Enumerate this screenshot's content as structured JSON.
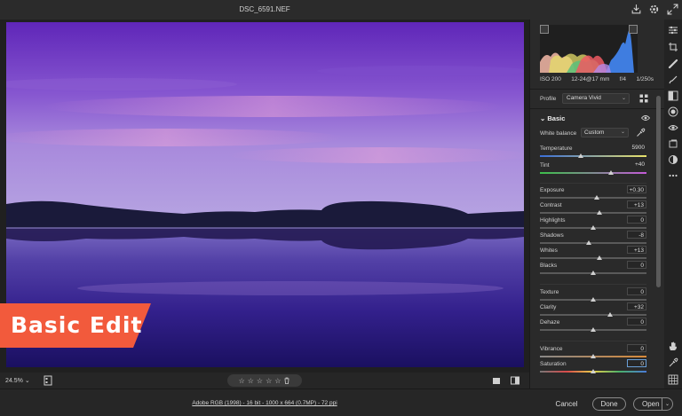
{
  "window": {
    "title": "DSC_6591.NEF"
  },
  "overlay": {
    "label": "Basic Edit",
    "color": "#f25a3c"
  },
  "toolbar": {
    "zoom": "24.5%",
    "zoom_caret": "⌄"
  },
  "rating": {
    "stars": [
      "☆",
      "☆",
      "☆",
      "☆",
      "☆"
    ]
  },
  "footer": {
    "file_info": "Adobe RGB (1998) - 16 bit - 1000 x 664 (0.7MP) - 72 ppi",
    "cancel": "Cancel",
    "done": "Done",
    "open": "Open",
    "open_caret": "⌄"
  },
  "exif": {
    "iso": "ISO 200",
    "lens": "12-24@17 mm",
    "aperture": "f/4",
    "shutter": "1/250s"
  },
  "profile": {
    "label": "Profile",
    "value": "Camera Vivid"
  },
  "basic": {
    "title": "Basic",
    "white_balance_label": "White balance",
    "white_balance_value": "Custom",
    "sliders": [
      {
        "label": "Temperature",
        "value": "5900",
        "pos": 0.38,
        "boxed": false,
        "track": "temp"
      },
      {
        "label": "Tint",
        "value": "+40",
        "pos": 0.67,
        "boxed": false,
        "track": "tint"
      },
      {
        "label": "Exposure",
        "value": "+0.30",
        "pos": 0.53,
        "boxed": true,
        "track": "plain"
      },
      {
        "label": "Contrast",
        "value": "+13",
        "pos": 0.56,
        "boxed": true,
        "track": "plain"
      },
      {
        "label": "Highlights",
        "value": "0",
        "pos": 0.5,
        "boxed": true,
        "track": "plain"
      },
      {
        "label": "Shadows",
        "value": "-8",
        "pos": 0.46,
        "boxed": true,
        "track": "plain"
      },
      {
        "label": "Whites",
        "value": "+13",
        "pos": 0.56,
        "boxed": true,
        "track": "plain"
      },
      {
        "label": "Blacks",
        "value": "0",
        "pos": 0.5,
        "boxed": true,
        "track": "plain"
      },
      {
        "label": "Texture",
        "value": "0",
        "pos": 0.5,
        "boxed": true,
        "track": "plain"
      },
      {
        "label": "Clarity",
        "value": "+32",
        "pos": 0.66,
        "boxed": true,
        "track": "plain"
      },
      {
        "label": "Dehaze",
        "value": "0",
        "pos": 0.5,
        "boxed": true,
        "track": "plain"
      },
      {
        "label": "Vibrance",
        "value": "0",
        "pos": 0.5,
        "boxed": true,
        "track": "vib"
      },
      {
        "label": "Saturation",
        "value": "0",
        "pos": 0.5,
        "boxed": true,
        "track": "sat",
        "active": true
      }
    ]
  },
  "colors": {
    "accent": "#6aa0d8",
    "badge": "#f25a3c",
    "sky_top": "#6a2fc0",
    "sky_mid": "#a88bde",
    "water": "#28197a"
  }
}
